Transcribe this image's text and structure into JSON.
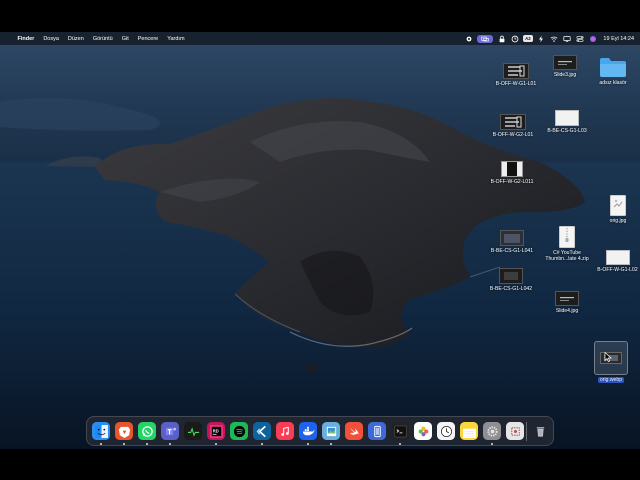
{
  "menubar": {
    "app_name": "Finder",
    "items": [
      "Dosya",
      "Düzen",
      "Görüntü",
      "Git",
      "Pencere",
      "Yardım"
    ],
    "status_icons": [
      "bluetooth-icon",
      "screen-mirror-icon",
      "lock-icon",
      "clock-icon",
      "input-source-icon",
      "bolt-icon",
      "wifi-icon",
      "display-icon",
      "control-center-icon",
      "siri-icon"
    ],
    "input_source": "A2",
    "clock": "19 Eyl 14:24"
  },
  "desktop": {
    "icons": [
      {
        "name": "B-OFF-W-G1-L01"
      },
      {
        "name": "Slide3.jpg"
      },
      {
        "name": "adsız klasör"
      },
      {
        "name": "B-OFF-W-G2-L01"
      },
      {
        "name": "B-BE-CS-G1-L03"
      },
      {
        "name": "B-OFF-W-G2-L011"
      },
      {
        "name": "orig.jpg"
      },
      {
        "name": "B-BE-CS-G1-L041"
      },
      {
        "name": "C# YouTube Thumbn...late 4.zip",
        "line1": "C# YouTube",
        "line2": "Thumbn...late 4.zip"
      },
      {
        "name": "B-OFF-W-G1-L02"
      },
      {
        "name": "B-BE-CS-G1-L042"
      },
      {
        "name": "Slide4.jpg"
      },
      {
        "name": "orig.webp",
        "selected": true
      }
    ]
  },
  "dock": {
    "apps": [
      {
        "name": "Finder",
        "color": "#2a8ff0",
        "running": true
      },
      {
        "name": "Brave",
        "color": "#e8542c",
        "running": true
      },
      {
        "name": "WhatsApp",
        "color": "#25d366",
        "running": true
      },
      {
        "name": "Microsoft Teams",
        "color": "#5b5fc7",
        "running": true
      },
      {
        "name": "Activity Monitor",
        "color": "#1a1a1a",
        "running": false
      },
      {
        "name": "Rider",
        "color": "#c2185b",
        "running": true
      },
      {
        "name": "Spotify",
        "color": "#1db954",
        "running": false
      },
      {
        "name": "Visual Studio Code",
        "color": "#0e639c",
        "running": true
      },
      {
        "name": "Music",
        "color": "#fa3c55",
        "running": false
      },
      {
        "name": "Docker",
        "color": "#1d63ed",
        "running": true
      },
      {
        "name": "Preview",
        "color": "#6aaede",
        "running": true
      },
      {
        "name": "Swift",
        "color": "#f05138",
        "running": false
      },
      {
        "name": "Simulator",
        "color": "#3d6ad6",
        "running": false
      },
      {
        "name": "Terminal",
        "color": "#222222",
        "running": true
      },
      {
        "name": "Photos",
        "color": "#ffffff",
        "running": false
      },
      {
        "name": "Clock",
        "color": "#f4f4f4",
        "running": false
      },
      {
        "name": "Notes",
        "color": "#fbd63d",
        "running": false
      },
      {
        "name": "System Settings",
        "color": "#8e8e93",
        "running": true
      },
      {
        "name": "Screenshot",
        "color": "#e6e6e6",
        "running": false
      }
    ],
    "trash": {
      "name": "Trash"
    }
  }
}
